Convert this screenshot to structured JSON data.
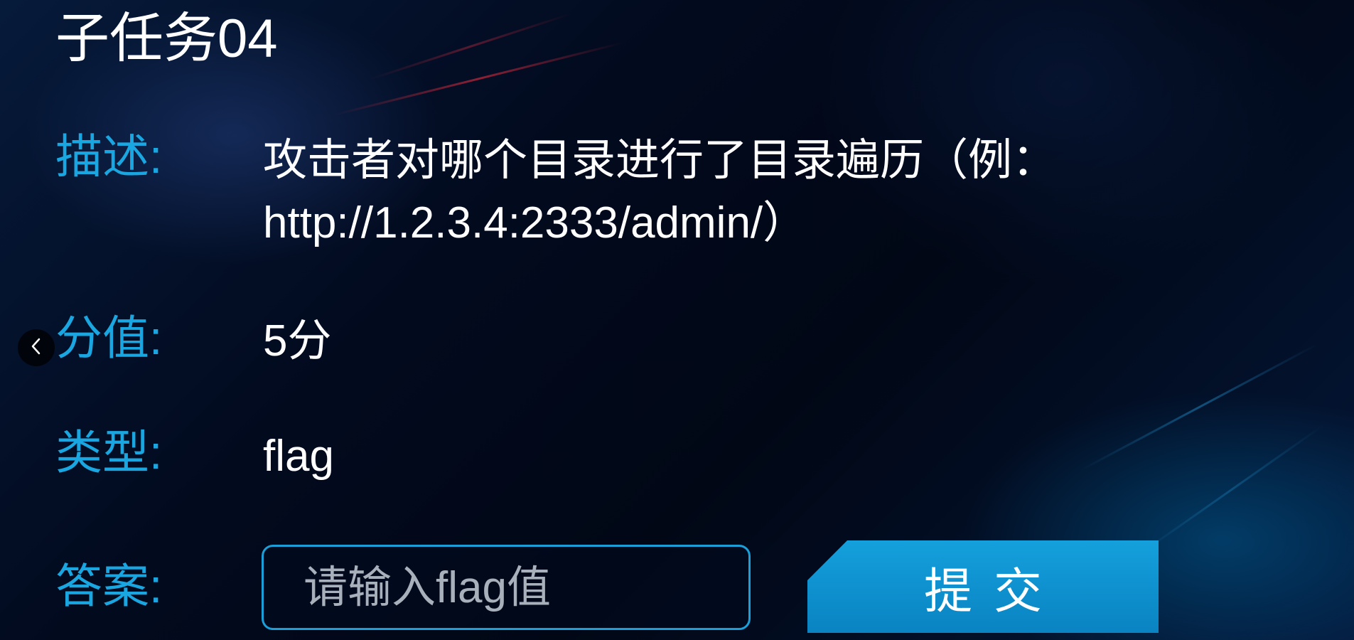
{
  "task": {
    "title": "子任务04",
    "description_label": "描述:",
    "description": "攻击者对哪个目录进行了目录遍历（例：http://1.2.3.4:2333/admin/）",
    "score_label": "分值:",
    "score": "5分",
    "type_label": "类型:",
    "type": "flag",
    "answer_label": "答案:",
    "answer_placeholder": "请输入flag值",
    "answer_value": "",
    "submit_label": "提交"
  },
  "nav": {
    "prev_icon": "chevron-left-icon"
  },
  "colors": {
    "label": "#1aa6e0",
    "accent": "#1aa6e0",
    "button": "#0f94d2",
    "text": "#ffffff"
  }
}
